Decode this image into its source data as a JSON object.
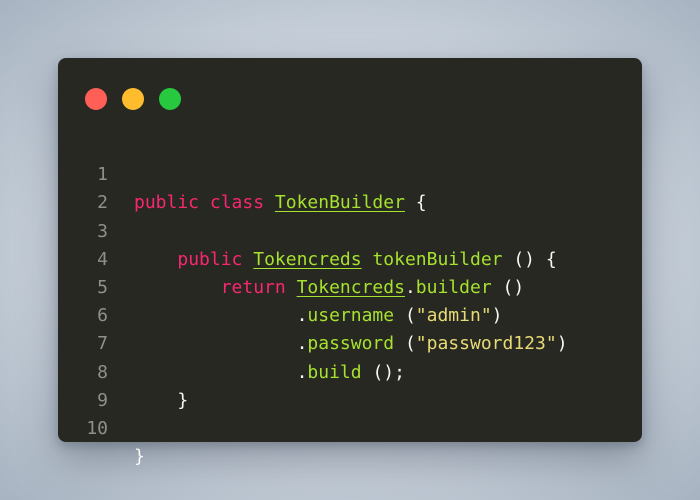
{
  "window": {
    "controls": {
      "close_color": "#ff5f56",
      "minimize_color": "#ffbd2e",
      "maximize_color": "#27c93f"
    }
  },
  "code": {
    "lines": [
      {
        "number": "1",
        "tokens": {
          "kw1": "public class",
          "cls": "TokenBuilder",
          "rest": "{"
        }
      },
      {
        "number": "2"
      },
      {
        "number": "3",
        "tokens": {
          "kw1": "public",
          "cls": "Tokencreds",
          "fn": "tokenBuilder",
          "rest": "() {"
        }
      },
      {
        "number": "4",
        "tokens": {
          "kw1": "return",
          "cls": "Tokencreds",
          "dot": ".",
          "fn": "builder",
          "rest": "()"
        }
      },
      {
        "number": "5",
        "tokens": {
          "dot": ".",
          "fn": "username",
          "open": "(",
          "str": "\"admin\"",
          "close": ")"
        }
      },
      {
        "number": "6",
        "tokens": {
          "dot": ".",
          "fn": "password",
          "open": "(",
          "str": "\"password123\"",
          "close": ")"
        }
      },
      {
        "number": "7",
        "tokens": {
          "dot": ".",
          "fn": "build",
          "rest": "();"
        }
      },
      {
        "number": "8",
        "tokens": {
          "rest": "}"
        }
      },
      {
        "number": "9"
      },
      {
        "number": "10",
        "tokens": {
          "rest": "}"
        }
      }
    ]
  },
  "colors": {
    "background": "#272822",
    "keyword": "#f92672",
    "class_name": "#a6e22e",
    "function": "#a6e22e",
    "string": "#e6db74",
    "line_number": "#8f908a",
    "text": "#f8f8f2"
  }
}
